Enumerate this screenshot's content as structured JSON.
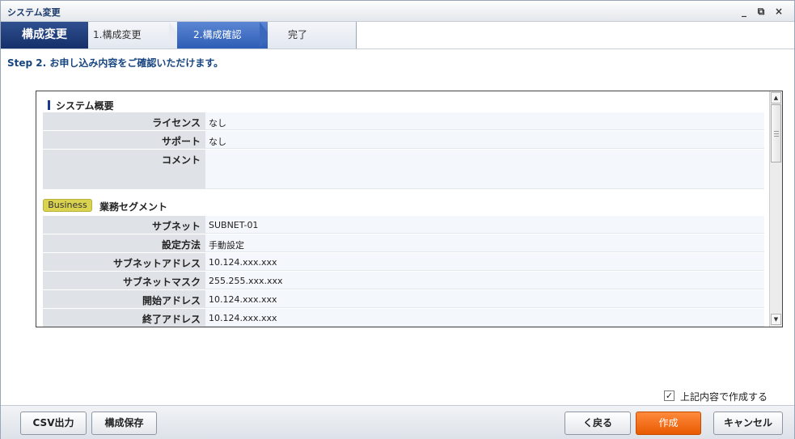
{
  "window": {
    "title": "システム変更",
    "controls": [
      "_",
      "⧉",
      "×"
    ]
  },
  "steps": {
    "main": "構成変更",
    "items": [
      {
        "label": "1.構成変更"
      },
      {
        "label": "2.構成確認"
      },
      {
        "label": "完了"
      }
    ]
  },
  "step_caption": "Step 2. お申し込み内容をご確認いただけます。",
  "sections": {
    "system": {
      "title": "システム概要",
      "rows": [
        {
          "label": "ライセンス",
          "value": "なし"
        },
        {
          "label": "サポート",
          "value": "なし"
        },
        {
          "label": "コメント",
          "value": ""
        }
      ]
    },
    "business": {
      "badge": "Business",
      "title": "業務セグメント",
      "rows": [
        {
          "label": "サブネット",
          "value": "SUBNET-01"
        },
        {
          "label": "設定方法",
          "value": "手動設定"
        },
        {
          "label": "サブネットアドレス",
          "value": "10.124.xxx.xxx"
        },
        {
          "label": "サブネットマスク",
          "value": "255.255.xxx.xxx"
        },
        {
          "label": "開始アドレス",
          "value": "10.124.xxx.xxx"
        },
        {
          "label": "終了アドレス",
          "value": "10.124.xxx.xxx"
        }
      ]
    }
  },
  "confirm_checkbox": {
    "label": "上記内容で作成する",
    "checked": true,
    "mark": "✓"
  },
  "footer": {
    "csv_label": "CSV出力",
    "save_label": "構成保存",
    "back_label": "く戻る",
    "create_label": "作成",
    "cancel_label": "キャンセル"
  },
  "colors": {
    "step_main": "#15306a",
    "step_active": "#2d5db5",
    "caption": "#16457f",
    "create_button": "#e85a00",
    "badge": "#d9d34f"
  }
}
